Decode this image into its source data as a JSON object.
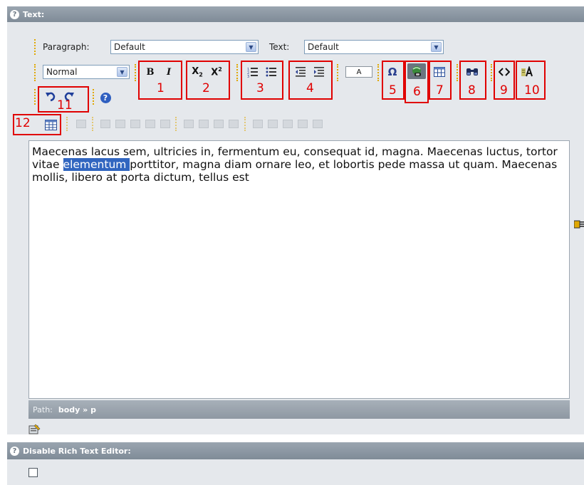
{
  "text_section": {
    "label": "Text:"
  },
  "toolbar": {
    "paragraph_label": "Paragraph:",
    "paragraph_value": "Default",
    "text_label": "Text:",
    "text_value": "Default",
    "block_style_value": "Normal",
    "bold": "B",
    "italic": "I",
    "font_color_letter": "A",
    "special_char": "Ω"
  },
  "annotations": [
    "1",
    "2",
    "3",
    "4",
    "5",
    "6",
    "7",
    "8",
    "9",
    "10",
    "11",
    "12"
  ],
  "editor": {
    "text_before": "Maecenas lacus sem, ultricies in, fermentum eu, consequat id, magna. Maecenas luctus, tortor vitae ",
    "selected": "elementum ",
    "text_after": "porttitor, magna diam ornare leo, et lobortis pede massa ut quam. Maecenas mollis, libero at porta dictum, tellus est"
  },
  "path": {
    "label": "Path:",
    "items": "body » p"
  },
  "disable_section": {
    "label": "Disable Rich Text Editor:"
  },
  "icons": [
    "help-icon",
    "bold-icon",
    "italic-icon",
    "subscript-icon",
    "superscript-icon",
    "ordered-list-icon",
    "unordered-list-icon",
    "outdent-icon",
    "indent-icon",
    "font-color-icon",
    "special-char-icon",
    "link-icon",
    "table-icon",
    "find-icon",
    "source-icon",
    "spellcheck-icon",
    "undo-icon",
    "redo-icon",
    "about-icon",
    "insert-table-icon"
  ]
}
